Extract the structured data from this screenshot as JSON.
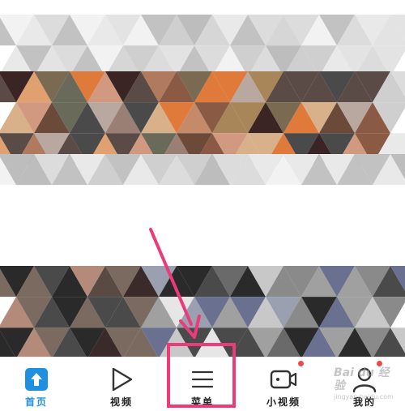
{
  "tabs": [
    {
      "id": "home",
      "label": "首页",
      "icon": "home-icon",
      "active": true
    },
    {
      "id": "video",
      "label": "视频",
      "icon": "play-icon",
      "active": false
    },
    {
      "id": "menu",
      "label": "菜单",
      "icon": "menu-icon",
      "active": false
    },
    {
      "id": "small-video",
      "label": "小视频",
      "icon": "camera-icon",
      "active": false,
      "badge": true
    },
    {
      "id": "mine",
      "label": "我的",
      "icon": "user-icon",
      "active": false,
      "badge": true
    }
  ],
  "watermark": {
    "brand": "Bai du 经验",
    "url": "jingyan.baidu.com"
  },
  "colors": {
    "accent": "#1f8fe0",
    "highlight": "#ec3b7a",
    "badge": "#f04848",
    "text": "#222222"
  }
}
